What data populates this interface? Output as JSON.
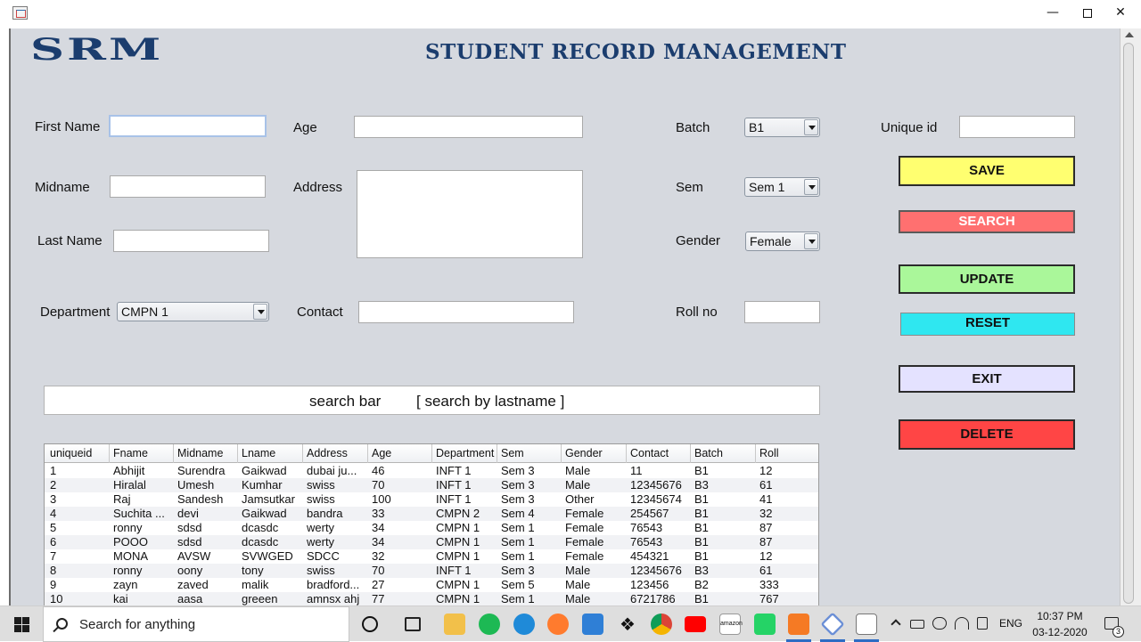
{
  "window": {
    "icon": "java-app-icon",
    "controls": {
      "minimize": "—",
      "close": "✕"
    }
  },
  "app": {
    "logo_text": "SRM",
    "title": "STUDENT RECORD MANAGEMENT",
    "colors": {
      "title": "#1b3d6e",
      "background": "#d6d9df"
    }
  },
  "form": {
    "first_name": {
      "label": "First Name",
      "value": ""
    },
    "midname": {
      "label": "Midname",
      "value": ""
    },
    "last_name": {
      "label": "Last Name",
      "value": ""
    },
    "department": {
      "label": "Department",
      "selected": "CMPN 1"
    },
    "age": {
      "label": "Age",
      "value": ""
    },
    "address": {
      "label": "Address",
      "value": ""
    },
    "contact": {
      "label": "Contact",
      "value": ""
    },
    "batch": {
      "label": "Batch",
      "selected": "B1"
    },
    "sem": {
      "label": "Sem",
      "selected": "Sem 1"
    },
    "gender": {
      "label": "Gender",
      "selected": "Female"
    },
    "roll_no": {
      "label": "Roll no",
      "value": ""
    },
    "unique_id": {
      "label": "Unique id",
      "value": ""
    }
  },
  "buttons": {
    "save": {
      "label": "SAVE",
      "color": "#ffff70"
    },
    "search": {
      "label": "SEARCH",
      "color": "#ff7070"
    },
    "update": {
      "label": "UPDATE",
      "color": "#aaf79a"
    },
    "reset": {
      "label": "RESET",
      "color": "#2fe7f0"
    },
    "exit": {
      "label": "EXIT",
      "color": "#e4e2ff"
    },
    "delete": {
      "label": "DELETE",
      "color": "#ff4545"
    }
  },
  "searchbar": {
    "text1": "search bar",
    "text2": "[ search by lastname ]"
  },
  "table": {
    "columns": [
      "uniqueid",
      "Fname",
      "Midname",
      "Lname",
      "Address",
      "Age",
      "Department",
      "Sem",
      "Gender",
      "Contact",
      "Batch",
      "Roll"
    ],
    "rows": [
      [
        "1",
        "Abhijit",
        "Surendra",
        "Gaikwad",
        "dubai ju...",
        "46",
        "INFT 1",
        "Sem 3",
        "Male",
        "11",
        "B1",
        "12"
      ],
      [
        "2",
        "Hiralal",
        "Umesh",
        "Kumhar",
        "swiss",
        "70",
        "INFT 1",
        "Sem 3",
        "Male",
        "12345676",
        "B3",
        "61"
      ],
      [
        "3",
        "Raj",
        "Sandesh",
        "Jamsutkar",
        "swiss",
        "100",
        "INFT 1",
        "Sem 3",
        "Other",
        "12345674",
        "B1",
        "41"
      ],
      [
        "4",
        "Suchita ...",
        "devi",
        "Gaikwad",
        "bandra",
        "33",
        "CMPN 2",
        "Sem 4",
        "Female",
        "254567",
        "B1",
        "32"
      ],
      [
        "5",
        "ronny",
        "sdsd",
        "dcasdc",
        "werty",
        "34",
        "CMPN 1",
        "Sem 1",
        "Female",
        "76543",
        "B1",
        "87"
      ],
      [
        "6",
        "POOO",
        "sdsd",
        "dcasdc",
        "werty",
        "34",
        "CMPN 1",
        "Sem 1",
        "Female",
        "76543",
        "B1",
        "87"
      ],
      [
        "7",
        "MONA",
        "AVSW",
        "SVWGED",
        "SDCC",
        "32",
        "CMPN 1",
        "Sem 1",
        "Female",
        "454321",
        "B1",
        "12"
      ],
      [
        "8",
        "ronny",
        "oony",
        "tony",
        "swiss",
        "70",
        "INFT 1",
        "Sem 3",
        "Male",
        "12345676",
        "B3",
        "61"
      ],
      [
        "9",
        "zayn",
        "zaved",
        "malik",
        "bradford...",
        "27",
        "CMPN 1",
        "Sem 5",
        "Male",
        "123456",
        "B2",
        "333"
      ],
      [
        "10",
        "kai",
        "aasa",
        "greeen",
        "amnsx ahj",
        "77",
        "CMPN 1",
        "Sem 1",
        "Male",
        "6721786",
        "B1",
        "767"
      ]
    ]
  },
  "taskbar": {
    "search_placeholder": "Search for anything",
    "pinned": [
      "cortana-icon",
      "task-view-icon",
      "file-explorer-icon",
      "spotify-icon",
      "edge-icon",
      "firefox-icon",
      "mail-icon",
      "dropbox-icon",
      "chrome-icon",
      "youtube-icon",
      "amazon-icon",
      "whatsapp-icon",
      "xampp-icon",
      "app-icon",
      "java-icon"
    ],
    "amazon_text": "amazon",
    "dropbox_glyph": "❖",
    "language": "ENG",
    "time": "10:37 PM",
    "date": "03-12-2020",
    "notification_count": "3"
  }
}
